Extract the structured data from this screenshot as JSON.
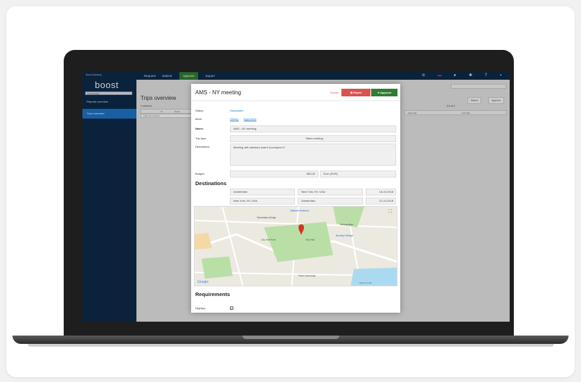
{
  "app": {
    "brand_small": "Boost Advisory",
    "logo": "boost",
    "sidebar_search_placeholder": "Desktop/Mob",
    "sidebar_items": [
      {
        "label": "Reports overview"
      },
      {
        "label": "Trips overview",
        "active": true
      }
    ],
    "nav": [
      "Request",
      "Submit",
      "Approve",
      "Export"
    ],
    "nav_active": "Approve",
    "page_title": "Trips overview",
    "selected_text": "0 selected",
    "table_columns": [
      "",
      "Nr",
      "Name"
    ],
    "table_empty": "Trips are not here",
    "right_buttons": [
      "Reject",
      "Approve"
    ],
    "pager": "0-0 of 0",
    "right_table_columns": [
      "Start date",
      "End date"
    ]
  },
  "modal": {
    "title": "AMS - NY meeting",
    "cancel_label": "Cancel",
    "reject_label": "Reject",
    "approve_label": "Approve",
    "status_label": "Status:",
    "status_value": "Requested",
    "more_label": "More:",
    "more_links": [
      "History",
      "Approvers"
    ],
    "name_label": "Name:",
    "name_value": "AMS - NY meeting",
    "trip_type_label": "Trip type:",
    "trip_type_value": "Sales meeting",
    "description_label": "Description:",
    "description_value": "Meeting with advisory board of prospect X",
    "budget_label": "Budget:",
    "budget_value": "850,00",
    "budget_currency": "Euro (EUR)",
    "destinations_heading": "Destinations",
    "destinations": [
      {
        "from": "Amsterdam",
        "to": "New York, NY, USA",
        "date": "16-10-2018"
      },
      {
        "from": "New York, NY, USA",
        "to": "Amsterdam",
        "date": "22-10-2018"
      }
    ],
    "requirements_heading": "Requirements",
    "flight_label": "Flight(s)",
    "flight_checked": true
  },
  "map": {
    "labels": [
      "Manhattan Bridge",
      "National Museum",
      "City Hall Park",
      "City Hall",
      "Brooklyn Bridge",
      "Pace University",
      "Metropolitan",
      "Google"
    ],
    "footer": "Terms of Use"
  },
  "colors": {
    "sidebar": "#0e2a4a",
    "accent": "#1f74c8",
    "approve": "#2f7d32",
    "reject": "#d9534f"
  }
}
